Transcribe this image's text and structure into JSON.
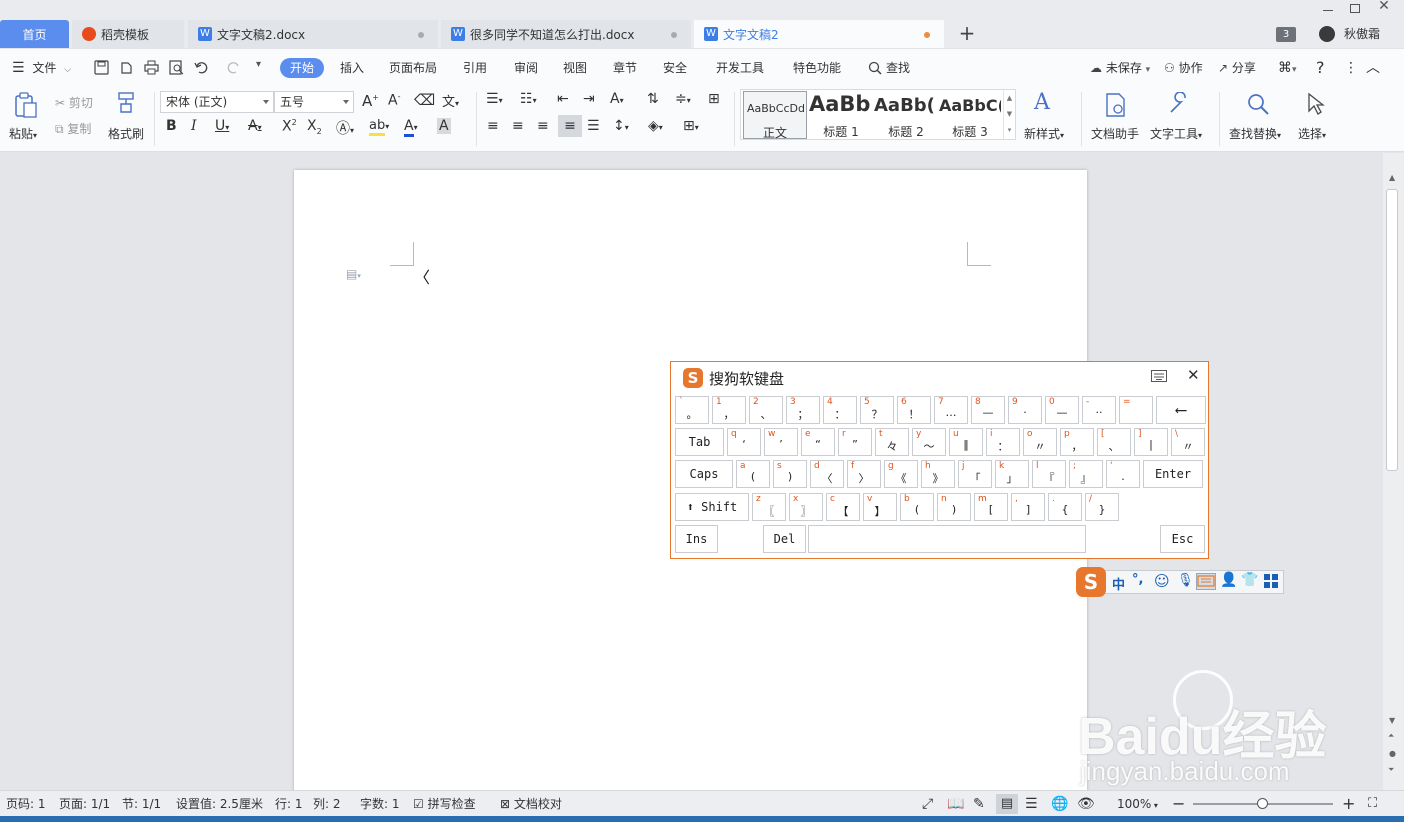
{
  "tabs": [
    {
      "label": "首页",
      "active": true
    },
    {
      "label": "稻壳模板"
    },
    {
      "label": "文字文稿2.docx"
    },
    {
      "label": "很多同学不知道怎么打出.docx"
    },
    {
      "label": "文字文稿2",
      "current": true
    }
  ],
  "window": {
    "badge": "3",
    "user": "秋傲霜"
  },
  "menubar": {
    "file": "文件",
    "items": [
      "开始",
      "插入",
      "页面布局",
      "引用",
      "审阅",
      "视图",
      "章节",
      "安全",
      "开发工具",
      "特色功能"
    ],
    "search": "查找",
    "unsaved": "未保存",
    "collab": "协作",
    "share": "分享"
  },
  "ribbon": {
    "paste": "粘贴",
    "cut": "剪切",
    "copy": "复制",
    "format_painter": "格式刷",
    "font": "宋体 (正文)",
    "size": "五号",
    "styles": [
      {
        "preview": "AaBbCcDd",
        "name": "正文"
      },
      {
        "preview": "AaBb",
        "name": "标题 1"
      },
      {
        "preview": "AaBb(",
        "name": "标题 2"
      },
      {
        "preview": "AaBbC(",
        "name": "标题 3"
      }
    ],
    "new_style": "新样式",
    "doc_assistant": "文档助手",
    "text_tools": "文字工具",
    "find_replace": "查找替换",
    "select": "选择"
  },
  "document": {
    "content": "〈"
  },
  "keyboard": {
    "title": "搜狗软键盘",
    "rows": [
      [
        {
          "s": "`",
          "b": "。"
        },
        {
          "s": "1",
          "b": "，"
        },
        {
          "s": "2",
          "b": "、"
        },
        {
          "s": "3",
          "b": "；"
        },
        {
          "s": "4",
          "b": "："
        },
        {
          "s": "5",
          "b": "？"
        },
        {
          "s": "6",
          "b": "！"
        },
        {
          "s": "7",
          "b": "…"
        },
        {
          "s": "8",
          "b": "—"
        },
        {
          "s": "9",
          "b": "·"
        },
        {
          "s": "0",
          "b": "—"
        },
        {
          "s": "-",
          "b": "··"
        },
        {
          "s": "=",
          "b": ""
        },
        {
          "s": "",
          "b": "⟵"
        }
      ],
      [
        {
          "s": "",
          "b": "Tab"
        },
        {
          "s": "q",
          "b": "‘"
        },
        {
          "s": "w",
          "b": "’"
        },
        {
          "s": "e",
          "b": "“"
        },
        {
          "s": "r",
          "b": "”"
        },
        {
          "s": "t",
          "b": "々"
        },
        {
          "s": "y",
          "b": "～"
        },
        {
          "s": "u",
          "b": "‖"
        },
        {
          "s": "i",
          "b": "："
        },
        {
          "s": "o",
          "b": "〃"
        },
        {
          "s": "p",
          "b": "，"
        },
        {
          "s": "[",
          "b": "、"
        },
        {
          "s": "]",
          "b": "|"
        },
        {
          "s": "\\",
          "b": "〃"
        }
      ],
      [
        {
          "s": "",
          "b": "Caps"
        },
        {
          "s": "a",
          "b": "("
        },
        {
          "s": "s",
          "b": ")"
        },
        {
          "s": "d",
          "b": "〈"
        },
        {
          "s": "f",
          "b": "〉"
        },
        {
          "s": "g",
          "b": "《"
        },
        {
          "s": "h",
          "b": "》"
        },
        {
          "s": "j",
          "b": "「"
        },
        {
          "s": "k",
          "b": "」"
        },
        {
          "s": "l",
          "b": "『"
        },
        {
          "s": ";",
          "b": "』"
        },
        {
          "s": "'",
          "b": "."
        },
        {
          "s": "",
          "b": "Enter"
        }
      ],
      [
        {
          "s": "",
          "b": "⬆ Shift"
        },
        {
          "s": "z",
          "b": "〖"
        },
        {
          "s": "x",
          "b": "〗"
        },
        {
          "s": "c",
          "b": "【"
        },
        {
          "s": "v",
          "b": "】"
        },
        {
          "s": "b",
          "b": "("
        },
        {
          "s": "n",
          "b": ")"
        },
        {
          "s": "m",
          "b": "["
        },
        {
          "s": ",",
          "b": "]"
        },
        {
          "s": ".",
          "b": "{"
        },
        {
          "s": "/",
          "b": "}"
        }
      ]
    ],
    "ins": "Ins",
    "del": "Del",
    "esc": "Esc"
  },
  "imebar": {
    "lang": "中",
    "punct": "°,"
  },
  "statusbar": {
    "page_no": "页码: 1",
    "pages": "页面: 1/1",
    "section": "节: 1/1",
    "setting": "设置值: 2.5厘米",
    "row": "行: 1",
    "col": "列: 2",
    "words": "字数: 1",
    "spell": "拼写检查",
    "proof": "文档校对",
    "zoom": "100%"
  },
  "watermark": {
    "text": "Baidu经验",
    "url": "jingyan.baidu.com"
  },
  "colors": {
    "accent": "#3c7ee6",
    "sogou": "#e6772c",
    "tab_active": "#5b8def"
  }
}
